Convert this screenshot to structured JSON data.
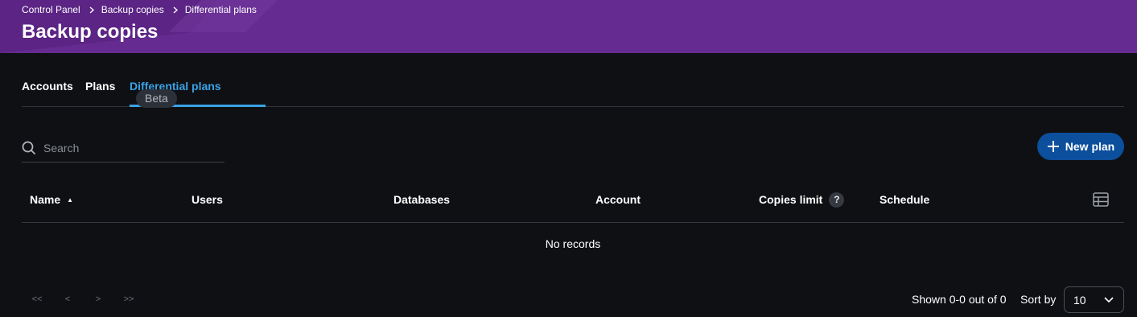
{
  "header": {
    "breadcrumb": [
      "Control Panel",
      "Backup copies",
      "Differential plans"
    ],
    "title": "Backup copies",
    "bg_color": "#652b91"
  },
  "tabs": [
    {
      "label": "Accounts",
      "active": false
    },
    {
      "label": "Plans",
      "active": false
    },
    {
      "label": "Differential plans",
      "active": true,
      "badge": "Beta"
    }
  ],
  "search": {
    "placeholder": "Search",
    "value": "",
    "icon": "search-icon"
  },
  "actions": {
    "new_plan_label": "New plan",
    "new_plan_icon": "plus-icon",
    "accent": "#0c4f9c"
  },
  "table": {
    "columns": [
      {
        "label": "Name",
        "sort": "ascending"
      },
      {
        "label": "Users"
      },
      {
        "label": "Databases"
      },
      {
        "label": "Account"
      },
      {
        "label": "Copies limit",
        "help": "?"
      },
      {
        "label": "Schedule"
      }
    ],
    "columns_settings_icon": "table-columns-icon",
    "empty_text": "No records"
  },
  "pagination": {
    "first": "<<",
    "prev": "<",
    "next": ">",
    "last": ">>",
    "shown_text": "Shown 0-0 out of 0",
    "sort_by_label": "Sort by",
    "page_size": "10"
  },
  "colors": {
    "background": "#0f1014",
    "active_tab": "#3aa3e6"
  }
}
